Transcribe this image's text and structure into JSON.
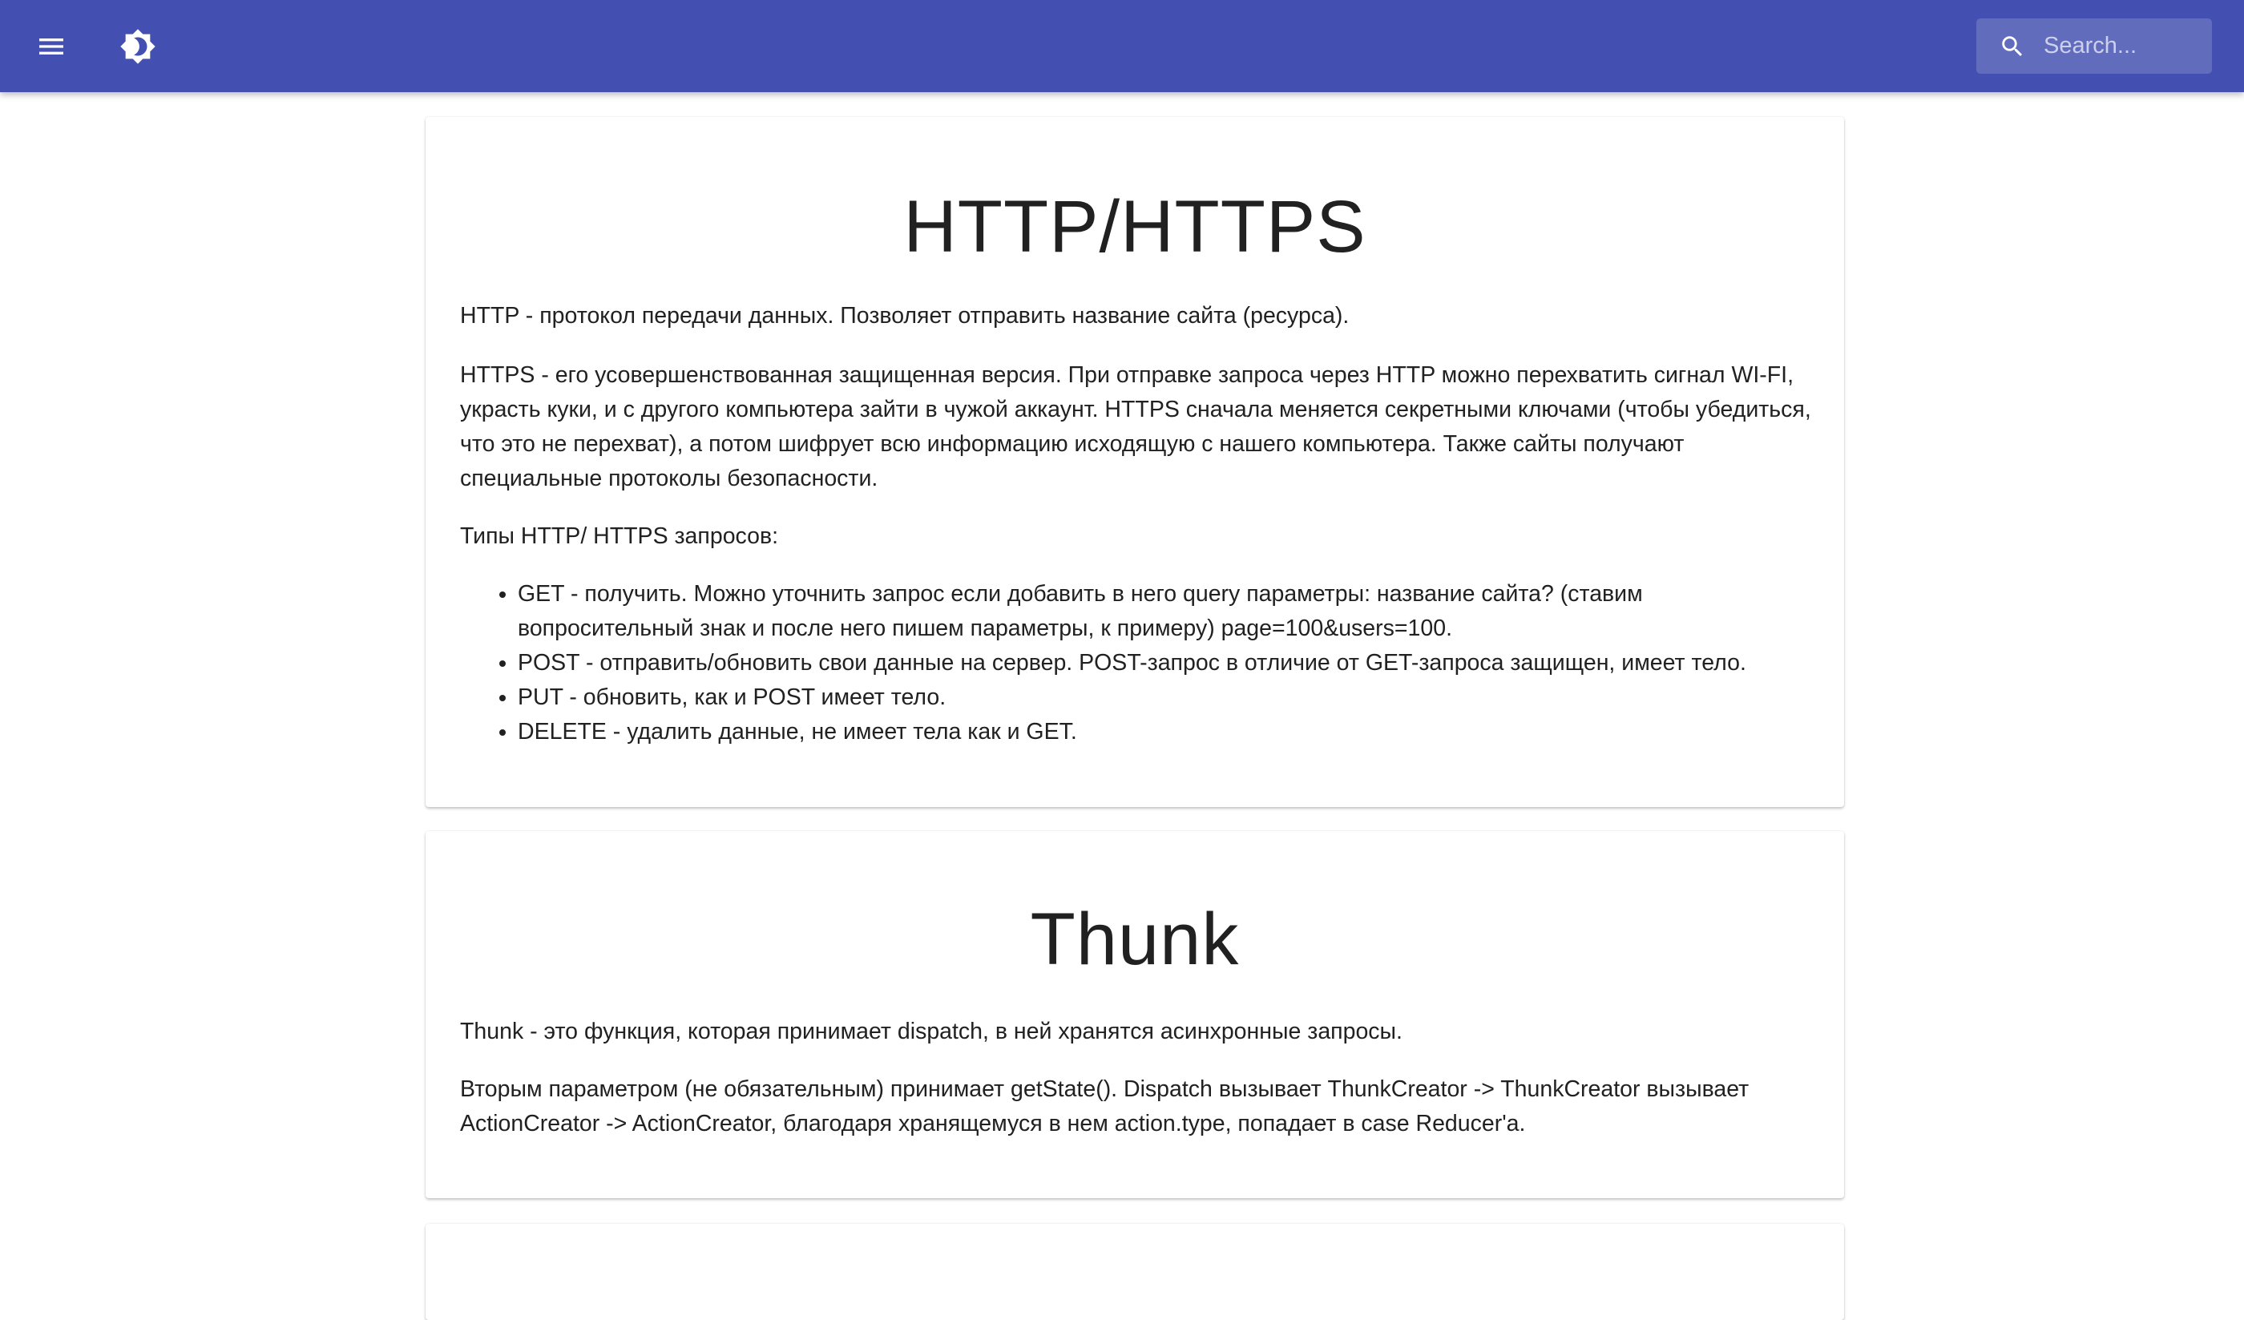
{
  "header": {
    "search_placeholder": "Search...",
    "bar_color": "#4350b1"
  },
  "icons": {
    "menu": "menu-icon",
    "theme": "brightness-icon",
    "search": "search-icon"
  },
  "sections": [
    {
      "title": "HTTP/HTTPS",
      "paragraphs": [
        "HTTP - протокол передачи данных. Позволяет отправить название сайта (ресурса).",
        "HTTPS - его усовершенствованная защищенная версия. При отправке запроса через HTTP можно перехватить сигнал WI-FI, украсть куки, и с другого компьютера зайти в чужой аккаунт. HTTPS сначала меняется секретными ключами (чтобы убедиться, что это не перехват), а потом шифрует всю информацию исходящую с нашего компьютера. Также сайты получают специальные протоколы безопасности.",
        "Типы HTTP/ HTTPS запросов:"
      ],
      "list": [
        "GET - получить. Можно уточнить запрос если добавить в него query параметры: название сайта? (ставим вопросительный знак и после него пишем параметры, к примеру) page=100&users=100.",
        "POST - отправить/обновить свои данные на сервер. POST-запрос в отличие от GET-запроса защищен, имеет тело.",
        "PUT - обновить, как и POST имеет тело.",
        "DELETE - удалить данные, не имеет тела как и GET."
      ]
    },
    {
      "title": "Thunk",
      "paragraphs": [
        "Thunk - это функция, которая принимает dispatch, в ней хранятся асинхронные запросы.",
        "Вторым параметром (не обязательным) принимает getState(). Dispatch вызывает ThunkCreator -> ThunkCreator вызывает ActionCreator -> ActionCreator, благодаря хранящемуся в нем action.type, попадает в case Reducer'a."
      ]
    }
  ]
}
